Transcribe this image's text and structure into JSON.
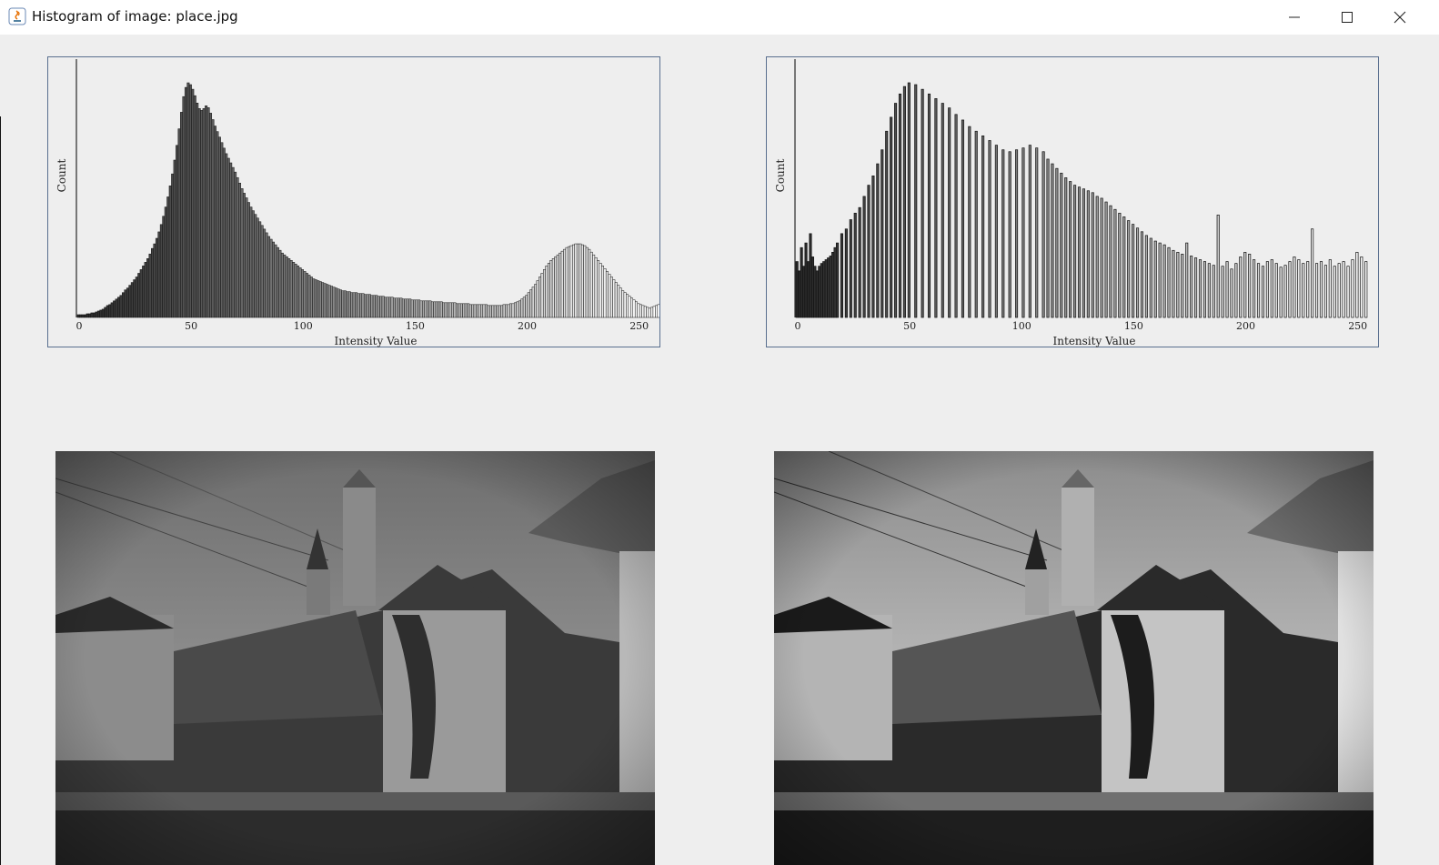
{
  "window": {
    "title": "Histogram of image: place.jpg",
    "controls": {
      "minimize": "minimize-icon",
      "maximize": "maximize-icon",
      "close": "close-icon"
    }
  },
  "histograms": [
    {
      "id": "original",
      "ylabel": "Count",
      "xlabel": "Intensity Value",
      "ticks": [
        "0",
        "50",
        "100",
        "150",
        "200",
        "250"
      ]
    },
    {
      "id": "equalized",
      "ylabel": "Count",
      "xlabel": "Intensity Value",
      "ticks": [
        "0",
        "50",
        "100",
        "150",
        "200",
        "250"
      ]
    }
  ],
  "chart_data": [
    {
      "type": "bar",
      "xlabel": "Intensity Value",
      "ylabel": "Count",
      "xlim": [
        0,
        255
      ],
      "x_ticks": [
        0,
        50,
        100,
        150,
        200,
        250
      ],
      "series": [
        {
          "values": [
            3,
            3,
            3,
            3,
            4,
            4,
            5,
            5,
            6,
            7,
            8,
            9,
            11,
            13,
            14,
            16,
            18,
            20,
            22,
            24,
            27,
            30,
            32,
            35,
            38,
            41,
            44,
            48,
            52,
            56,
            60,
            64,
            69,
            75,
            80,
            86,
            93,
            101,
            110,
            120,
            131,
            143,
            156,
            171,
            187,
            205,
            223,
            240,
            250,
            255,
            253,
            248,
            241,
            233,
            227,
            225,
            227,
            230,
            228,
            222,
            215,
            208,
            202,
            196,
            190,
            184,
            178,
            173,
            168,
            163,
            158,
            152,
            146,
            140,
            135,
            130,
            125,
            120,
            116,
            112,
            108,
            104,
            100,
            96,
            92,
            88,
            85,
            82,
            79,
            76,
            73,
            70,
            68,
            66,
            64,
            62,
            60,
            58,
            56,
            54,
            52,
            50,
            48,
            46,
            44,
            42,
            41,
            40,
            39,
            38,
            37,
            36,
            35,
            34,
            33,
            32,
            31,
            30,
            29,
            29,
            28,
            28,
            27,
            27,
            27,
            26,
            26,
            26,
            25,
            25,
            25,
            24,
            24,
            24,
            23,
            23,
            23,
            22,
            22,
            22,
            22,
            21,
            21,
            21,
            21,
            20,
            20,
            20,
            20,
            19,
            19,
            19,
            19,
            18,
            18,
            18,
            18,
            18,
            17,
            17,
            17,
            17,
            17,
            16,
            16,
            16,
            16,
            16,
            16,
            15,
            15,
            15,
            15,
            15,
            15,
            14,
            14,
            14,
            14,
            14,
            14,
            14,
            14,
            13,
            13,
            13,
            13,
            13,
            13,
            13,
            14,
            14,
            14,
            15,
            15,
            16,
            17,
            18,
            20,
            22,
            24,
            27,
            30,
            33,
            36,
            40,
            44,
            48,
            52,
            56,
            59,
            62,
            64,
            66,
            68,
            70,
            72,
            74,
            76,
            77,
            78,
            79,
            80,
            80,
            80,
            79,
            78,
            76,
            74,
            71,
            68,
            65,
            62,
            59,
            56,
            53,
            50,
            47,
            44,
            41,
            38,
            35,
            32,
            29,
            27,
            25,
            23,
            21,
            19,
            17,
            15,
            14,
            13,
            12,
            11,
            10,
            11,
            12,
            13,
            14
          ]
        }
      ]
    },
    {
      "type": "bar",
      "xlabel": "Intensity Value",
      "ylabel": "Count",
      "xlim": [
        0,
        255
      ],
      "x_ticks": [
        0,
        50,
        100,
        150,
        200,
        250
      ],
      "series": [
        {
          "x": [
            0,
            1,
            2,
            3,
            4,
            5,
            6,
            7,
            8,
            9,
            10,
            11,
            12,
            13,
            14,
            15,
            16,
            17,
            18,
            20,
            22,
            24,
            26,
            28,
            30,
            32,
            34,
            36,
            38,
            40,
            42,
            44,
            46,
            48,
            50,
            53,
            56,
            59,
            62,
            65,
            68,
            71,
            74,
            77,
            80,
            83,
            86,
            89,
            92,
            95,
            98,
            101,
            104,
            107,
            110,
            112,
            114,
            116,
            118,
            120,
            122,
            124,
            126,
            128,
            130,
            132,
            134,
            136,
            138,
            140,
            142,
            144,
            146,
            148,
            150,
            152,
            154,
            156,
            158,
            160,
            162,
            164,
            166,
            168,
            170,
            172,
            174,
            176,
            178,
            180,
            182,
            184,
            186,
            188,
            190,
            192,
            194,
            196,
            198,
            200,
            202,
            204,
            206,
            208,
            210,
            212,
            214,
            216,
            218,
            220,
            222,
            224,
            226,
            228,
            230,
            232,
            234,
            236,
            238,
            240,
            242,
            244,
            246,
            248,
            250,
            252,
            254
          ],
          "values": [
            60,
            50,
            75,
            55,
            80,
            60,
            90,
            65,
            55,
            50,
            55,
            58,
            60,
            62,
            64,
            66,
            70,
            75,
            80,
            90,
            95,
            105,
            112,
            118,
            130,
            142,
            152,
            165,
            180,
            200,
            215,
            230,
            240,
            248,
            252,
            250,
            245,
            240,
            235,
            230,
            225,
            218,
            212,
            205,
            200,
            195,
            190,
            185,
            180,
            178,
            180,
            182,
            185,
            182,
            178,
            170,
            165,
            160,
            155,
            150,
            146,
            142,
            140,
            138,
            136,
            134,
            130,
            128,
            124,
            120,
            116,
            112,
            108,
            104,
            100,
            96,
            92,
            88,
            85,
            82,
            80,
            78,
            75,
            72,
            70,
            68,
            80,
            66,
            64,
            62,
            60,
            58,
            56,
            110,
            55,
            60,
            52,
            58,
            65,
            70,
            68,
            62,
            58,
            55,
            60,
            62,
            58,
            54,
            56,
            60,
            65,
            62,
            58,
            60,
            95,
            58,
            60,
            56,
            62,
            55,
            58,
            60,
            55,
            62,
            70,
            65,
            60
          ]
        }
      ]
    }
  ]
}
